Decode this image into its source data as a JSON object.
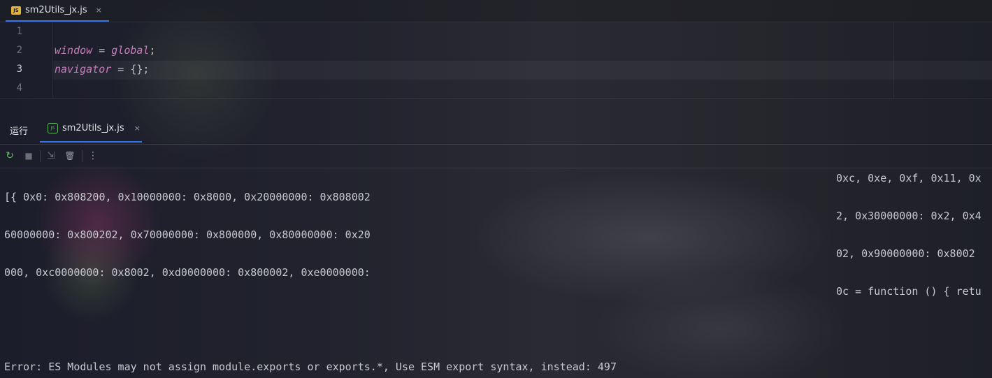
{
  "editor_tab": {
    "icon": "JS",
    "label": "sm2Utils_jx.js",
    "close": "×"
  },
  "editor": {
    "line_numbers": [
      "1",
      "2",
      "3",
      "4"
    ],
    "line2": {
      "var": "window",
      "op": " = ",
      "val": "global",
      "end": ";"
    },
    "line3": {
      "var": "navigator",
      "op": " = ",
      "val": "{};"
    }
  },
  "run_panel": {
    "title": "运行",
    "tab": {
      "icon": "JS",
      "label": "sm2Utils_jx.js",
      "close": "×"
    }
  },
  "toolbar": {
    "rerun": "↻",
    "stop": "■",
    "scroll": "⇲",
    "clear": "🗑",
    "more": "⋮"
  },
  "console": {
    "left_lines": [
      "[{ 0x0: 0x808200, 0x10000000: 0x8000, 0x20000000: 0x808002",
      "60000000: 0x800202, 0x70000000: 0x800000, 0x80000000: 0x20",
      "000, 0xc0000000: 0x8002, 0xd0000000: 0x800002, 0xe0000000:"
    ],
    "right_lines": [
      "0xc, 0xe, 0xf, 0x11, 0x",
      "2, 0x30000000: 0x2, 0x4",
      "02, 0x90000000: 0x8002",
      "0c = function () { retu"
    ],
    "error": "Error: ES Modules may not assign module.exports or exports.*, Use ESM export syntax, instead: 497"
  },
  "colors": {
    "accent": "#3574f0",
    "keyword": "#c77dbb",
    "js_badge": "#e6b43c",
    "node_green": "#5fb85f"
  }
}
